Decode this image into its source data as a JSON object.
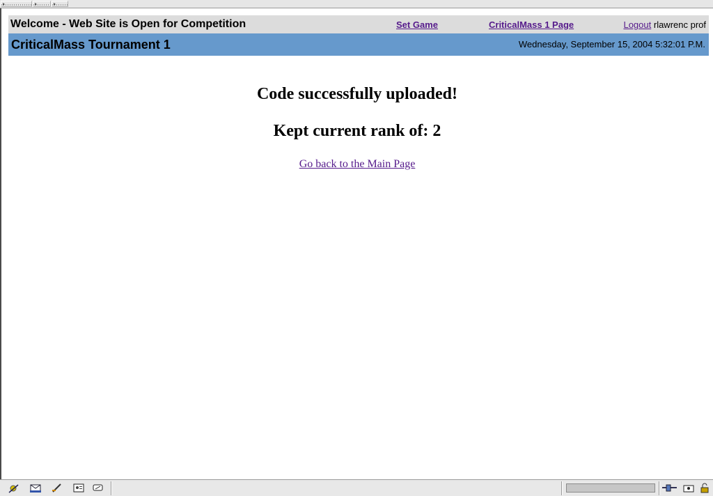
{
  "header": {
    "welcome": "Welcome - Web Site is Open for Competition",
    "set_game": "Set Game",
    "page_link": "CriticalMass 1 Page",
    "logout": "Logout",
    "user": "rlawrenc prof"
  },
  "title_bar": {
    "title": "CriticalMass Tournament 1",
    "datetime": "Wednesday, September 15, 2004 5:32:01 P.M."
  },
  "main": {
    "success": "Code successfully uploaded!",
    "rank": "Kept current rank of: 2",
    "back_link": "Go back to the Main Page"
  },
  "colors": {
    "welcome_bg": "#dcdcdc",
    "title_bg": "#6699cc",
    "link": "#551a8b"
  },
  "status_icons": [
    "navigator-icon",
    "mail-icon",
    "composer-icon",
    "address-book-icon",
    "irc-chat-icon"
  ]
}
